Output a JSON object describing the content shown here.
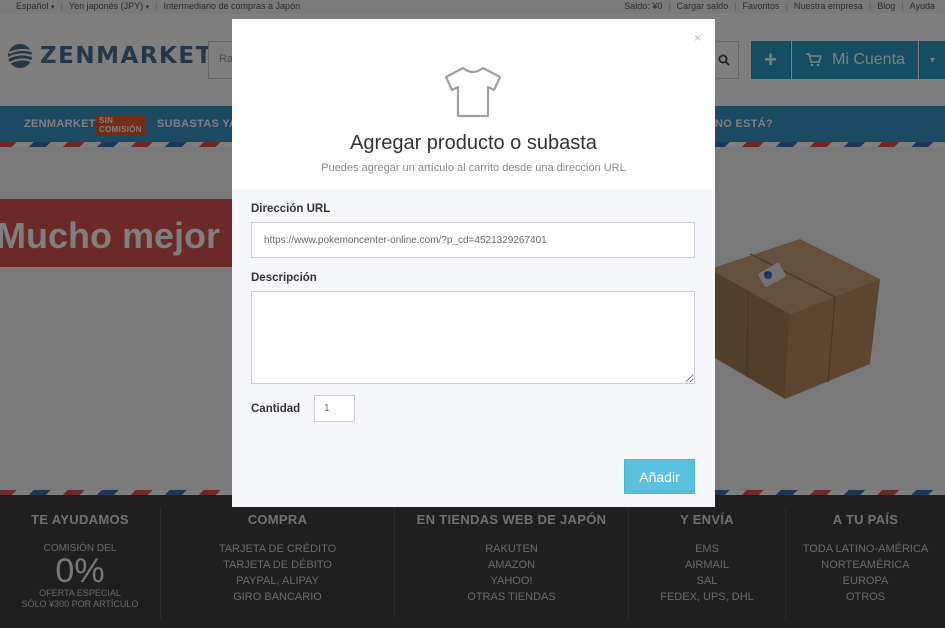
{
  "topbar": {
    "left": [
      {
        "label": "Español",
        "caret": "▾"
      },
      {
        "label": "Yen japonés (JPY)",
        "caret": "▾"
      },
      {
        "label": "Intermediario de compras a Japón",
        "caret": ""
      }
    ],
    "right": [
      "Saldo: ¥0",
      "Cargar saldo",
      "Favoritos",
      "Nuestra empresa",
      "Blog",
      "Ayuda"
    ]
  },
  "header": {
    "logo": "ZENMARKET",
    "search_placeholder": "Ra",
    "plus": "+",
    "account_label": "Mi Cuenta",
    "account_caret": "▾"
  },
  "nav": {
    "badge": "SIN COMISIÓN",
    "items": [
      "ZENMARKETPLACE",
      "SUBASTAS YA",
      "NO ESTÁ?"
    ]
  },
  "hero": {
    "headline": "Mucho mejor"
  },
  "footer": {
    "columns": [
      {
        "heading": "TE AYUDAMOS",
        "pre": "COMISIÓN DEL",
        "big": "0%",
        "post1": "OFERTA ESPECIAL",
        "post2": "SÓLO ¥300 POR ARTÍCULO"
      },
      {
        "heading": "COMPRA",
        "items": [
          "TARJETA DE CRÉDITO",
          "TARJETA DE DÉBITO",
          "PAYPAL, ALIPAY",
          "GIRO BANCARIO"
        ]
      },
      {
        "heading": "EN TIENDAS WEB DE JAPÓN",
        "items": [
          "RAKUTEN",
          "AMAZON",
          "YAHOO!",
          "OTRAS TIENDAS"
        ]
      },
      {
        "heading": "Y ENVÍA",
        "items": [
          "EMS",
          "AIRMAIL",
          "SAL",
          "FEDEX, UPS, DHL"
        ]
      },
      {
        "heading": "A TU PAÍS",
        "items": [
          "TODA LATINO-AMÉRICA",
          "NORTEAMÉRICA",
          "EUROPA",
          "OTROS"
        ]
      }
    ]
  },
  "modal": {
    "close": "×",
    "title": "Agregar producto o subasta",
    "subtitle": "Puedes agregar un artículo al carrito desde una dirección URL",
    "url_label": "Dirección URL",
    "url_value": "https://www.pokemoncenter-online.com/?p_cd=4521329267401",
    "desc_label": "Descripción",
    "desc_value": "",
    "qty_label": "Cantidad",
    "qty_value": "1",
    "add_button": "Añadir"
  },
  "colors": {
    "brand": "#4a6e8e",
    "primary": "#2a9dc7",
    "nav": "#3a94c6",
    "accent_red": "#d9534f",
    "add_button": "#5bc0de"
  }
}
